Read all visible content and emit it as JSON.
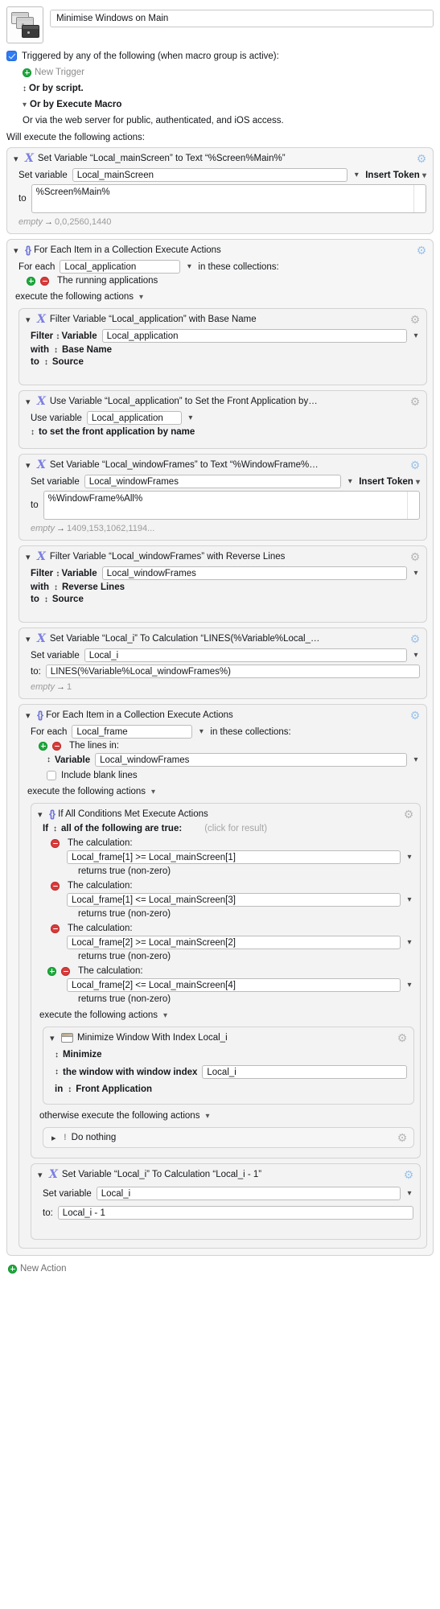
{
  "macro": {
    "title": "Minimise Windows on Main",
    "icon": "windows-stack-icon"
  },
  "triggers": {
    "enabled": true,
    "heading": "Triggered by any of the following (when macro group is active):",
    "new_trigger": "New Trigger",
    "or_by_script": "Or by script.",
    "or_by_execute_macro": "Or by Execute Macro",
    "web_server_note": "Or via the web server for public, authenticated, and iOS access.",
    "will_execute": "Will execute the following actions:"
  },
  "labels": {
    "set_variable": "Set variable",
    "to": "to",
    "to_colon": "to:",
    "insert_token": "Insert Token",
    "for_each": "For each",
    "in_collections": "in these collections:",
    "execute_following": "execute the following actions",
    "otherwise_execute": "otherwise execute the following actions",
    "filter": "Filter",
    "variable": "Variable",
    "with": "with",
    "use_variable": "Use variable",
    "the_running_applications": "The running applications",
    "the_lines_in": "The lines in:",
    "include_blank_lines": "Include blank lines",
    "if_prefix": "If",
    "all_true": "all of the following are true:",
    "click_for_result": "(click for result)",
    "the_calculation": "The calculation:",
    "returns_true": "returns true (non-zero)",
    "empty": "empty",
    "new_action": "New Action"
  },
  "actions": {
    "set_main_screen": {
      "title": "Set Variable “Local_mainScreen” to Text “%Screen%Main%”",
      "variable": "Local_mainScreen",
      "value": "%Screen%Main%",
      "result": "0,0,2560,1440"
    },
    "for_each_app": {
      "title": "For Each Item in a Collection Execute Actions",
      "loop_variable": "Local_application",
      "collection": "The running applications"
    },
    "filter_app": {
      "title": "Filter Variable “Local_application” with Base Name",
      "variable": "Local_application",
      "with": "Base Name",
      "to": "Source"
    },
    "use_var_front_app": {
      "title": "Use Variable “Local_application” to Set the Front Application by…",
      "variable": "Local_application",
      "mode": "to set the front application by name"
    },
    "set_window_frames": {
      "title": "Set Variable “Local_windowFrames” to Text “%WindowFrame%…",
      "variable": "Local_windowFrames",
      "value": "%WindowFrame%All%",
      "result": "1409,153,1062,1194..."
    },
    "filter_frames": {
      "title": "Filter Variable “Local_windowFrames” with Reverse Lines",
      "variable": "Local_windowFrames",
      "with": "Reverse Lines",
      "to": "Source"
    },
    "set_local_i": {
      "title": "Set Variable “Local_i” To Calculation “LINES(%Variable%Local_…",
      "variable": "Local_i",
      "calculation": "LINES(%Variable%Local_windowFrames%)",
      "result": "1"
    },
    "for_each_frame": {
      "title": "For Each Item in a Collection Execute Actions",
      "loop_variable": "Local_frame",
      "collection_label": "The lines in:",
      "source_kind": "Variable",
      "source_variable": "Local_windowFrames",
      "include_blank_lines": false
    },
    "if_all_conditions": {
      "title": "If All Conditions Met Execute Actions",
      "match_mode": "all of the following are true:",
      "conditions": [
        {
          "kind": "The calculation:",
          "expression": "Local_frame[1] >= Local_mainScreen[1]",
          "returns": "returns true (non-zero)",
          "has_add": false
        },
        {
          "kind": "The calculation:",
          "expression": "Local_frame[1] <= Local_mainScreen[3]",
          "returns": "returns true (non-zero)",
          "has_add": false
        },
        {
          "kind": "The calculation:",
          "expression": "Local_frame[2] >= Local_mainScreen[2]",
          "returns": "returns true (non-zero)",
          "has_add": false
        },
        {
          "kind": "The calculation:",
          "expression": "Local_frame[2] <= Local_mainScreen[4]",
          "returns": "returns true (non-zero)",
          "has_add": true
        }
      ]
    },
    "minimize_window": {
      "title": "Minimize Window With Index Local_i",
      "operation": "Minimize",
      "target_label": "the window with window index",
      "index_value": "Local_i",
      "in_label": "in",
      "scope": "Front Application"
    },
    "do_nothing": {
      "title": "Do nothing"
    },
    "decrement_i": {
      "title": "Set Variable “Local_i” To Calculation “Local_i - 1”",
      "variable": "Local_i",
      "calculation": "Local_i - 1"
    }
  },
  "colors": {
    "accent_blue": "#2f7bf6",
    "icon_purple": "#7b7fe0",
    "add_green": "#1faa3c",
    "remove_red": "#d93b3b",
    "muted_gray": "#9b9b9b"
  }
}
